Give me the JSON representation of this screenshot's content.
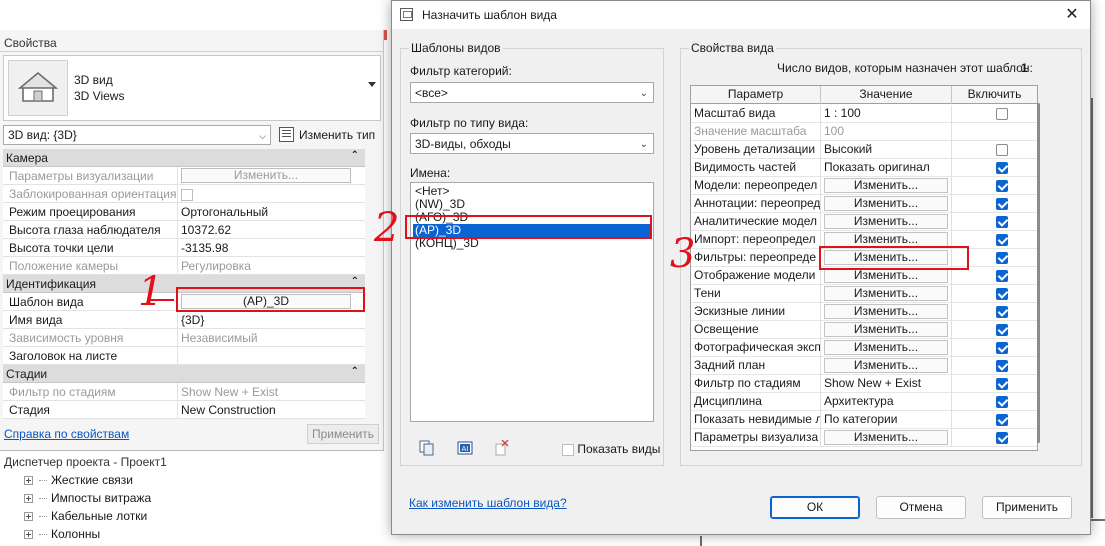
{
  "properties": {
    "title": "Свойства",
    "type_line1": "3D вид",
    "type_line2": "3D Views",
    "instance_filter": "3D вид: {3D}",
    "edit_type_label": "Изменить тип",
    "groups": [
      {
        "name": "Камера",
        "rows": [
          {
            "name": "Параметры визуализации",
            "value": "Изменить...",
            "disabled": true,
            "button": true
          },
          {
            "name": "Заблокированная ориентация",
            "value": "",
            "disabled": true,
            "checkbox": true
          },
          {
            "name": "Режим проецирования",
            "value": "Ортогональный"
          },
          {
            "name": "Высота глаза наблюдателя",
            "value": "10372.62"
          },
          {
            "name": "Высота точки цели",
            "value": "-3135.98"
          },
          {
            "name": "Положение камеры",
            "value": "Регулировка",
            "disabled": true
          }
        ]
      },
      {
        "name": "Идентификация",
        "rows": [
          {
            "name": "Шаблон вида",
            "value": "(АР)_3D",
            "button": true
          },
          {
            "name": "Имя вида",
            "value": "{3D}"
          },
          {
            "name": "Зависимость уровня",
            "value": "Независимый",
            "disabled": true
          },
          {
            "name": "Заголовок на листе",
            "value": ""
          }
        ]
      },
      {
        "name": "Стадии",
        "rows": [
          {
            "name": "Фильтр по стадиям",
            "value": "Show New + Exist",
            "disabled": true
          },
          {
            "name": "Стадия",
            "value": "New Construction"
          }
        ]
      }
    ],
    "help_link": "Справка по свойствам",
    "apply_label": "Применить"
  },
  "browser": {
    "title": "Диспетчер проекта - Проект1",
    "items": [
      "Жесткие связи",
      "Импосты витража",
      "Кабельные лотки",
      "Колонны"
    ]
  },
  "dialog": {
    "title": "Назначить шаблон вида",
    "close_glyph": "✕",
    "templates": {
      "legend": "Шаблоны видов",
      "category_filter_label": "Фильтр категорий:",
      "category_filter_value": "<все>",
      "view_type_filter_label": "Фильтр по типу вида:",
      "view_type_filter_value": "3D-виды, обходы",
      "names_label": "Имена:",
      "names": [
        "<Нет>",
        "(NW)_3D",
        "(АГО)_3D",
        "(АР)_3D",
        "(КОНЦ)_3D"
      ],
      "selected_index": 3,
      "show_views_label": "Показать виды"
    },
    "view_properties": {
      "legend": "Свойства вида",
      "count_label": "Число видов, которым назначен этот шаблон:",
      "count_value": "1",
      "columns": [
        "Параметр",
        "Значение",
        "Включить"
      ],
      "rows": [
        {
          "param": "Масштаб вида",
          "value": "1 : 100",
          "checked": false
        },
        {
          "param": "Значение масштаба",
          "value": "100",
          "disabled": true,
          "no_check": true
        },
        {
          "param": "Уровень детализации",
          "value": "Высокий",
          "checked": false
        },
        {
          "param": "Видимость частей",
          "value": "Показать оригинал",
          "checked": true
        },
        {
          "param": "Модели: переопредел",
          "value": "Изменить...",
          "button": true,
          "checked": true
        },
        {
          "param": "Аннотации: переопред",
          "value": "Изменить...",
          "button": true,
          "checked": true
        },
        {
          "param": "Аналитические модел",
          "value": "Изменить...",
          "button": true,
          "checked": true
        },
        {
          "param": "Импорт: переопредел",
          "value": "Изменить...",
          "button": true,
          "checked": true
        },
        {
          "param": "Фильтры: переопреде",
          "value": "Изменить...",
          "button": true,
          "checked": true
        },
        {
          "param": "Отображение модели",
          "value": "Изменить...",
          "button": true,
          "checked": true
        },
        {
          "param": "Тени",
          "value": "Изменить...",
          "button": true,
          "checked": true
        },
        {
          "param": "Эскизные линии",
          "value": "Изменить...",
          "button": true,
          "checked": true
        },
        {
          "param": "Освещение",
          "value": "Изменить...",
          "button": true,
          "checked": true
        },
        {
          "param": "Фотографическая эксп",
          "value": "Изменить...",
          "button": true,
          "checked": true
        },
        {
          "param": "Задний план",
          "value": "Изменить...",
          "button": true,
          "checked": true
        },
        {
          "param": "Фильтр по стадиям",
          "value": "Show New + Exist",
          "checked": true
        },
        {
          "param": "Дисциплина",
          "value": "Архитектура",
          "checked": true
        },
        {
          "param": "Показать невидимые л",
          "value": "По категории",
          "checked": true
        },
        {
          "param": "Параметры визуализа",
          "value": "Изменить...",
          "button": true,
          "checked": true
        }
      ]
    },
    "help_link": "Как изменить шаблон вида?",
    "ok_label": "ОК",
    "cancel_label": "Отмена",
    "apply_label": "Применить"
  },
  "annotations": {
    "one": "1",
    "two": "2",
    "three": "3",
    "color": "#e2101a"
  },
  "icons": {
    "house": "house-icon",
    "edit_type": "edit-type-icon",
    "duplicate": "duplicate-icon",
    "rename": "rename-icon",
    "delete": "delete-icon"
  }
}
